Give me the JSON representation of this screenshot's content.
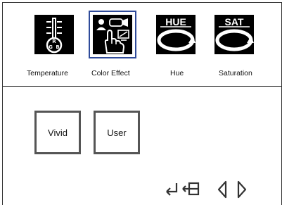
{
  "menu": {
    "items": [
      {
        "label": "Temperature",
        "icon": "thermometer-rgb-icon"
      },
      {
        "label": "Color Effect",
        "icon": "color-effect-hand-icon",
        "selected": true
      },
      {
        "label": "Hue",
        "icon": "hue-ring-icon",
        "badge": "HUE"
      },
      {
        "label": "Saturation",
        "icon": "saturation-ring-icon",
        "badge": "SAT"
      }
    ],
    "thermo_letters": [
      "R",
      "G",
      "B"
    ]
  },
  "options": {
    "vivid_label": "Vivid",
    "user_label": "User"
  },
  "navigation": {
    "icons": [
      "enter-icon",
      "exit-icon",
      "left-arrow-icon",
      "right-arrow-icon"
    ]
  },
  "colors": {
    "selection_outline": "#2f4b9a",
    "icon_background": "#000000",
    "button_border": "#555555"
  }
}
